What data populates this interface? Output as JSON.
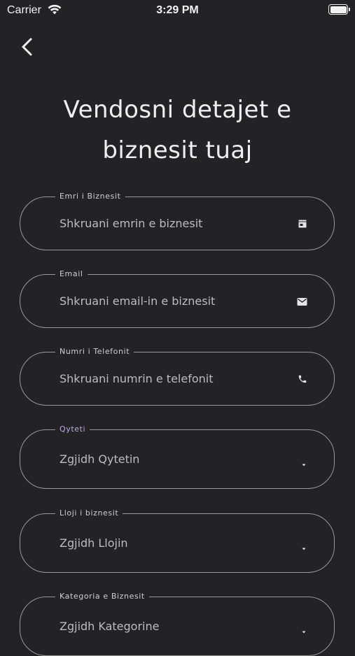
{
  "status_bar": {
    "carrier": "Carrier",
    "time": "3:29 PM"
  },
  "title": "Vendosni detajet e\nbiznesit tuaj",
  "fields": [
    {
      "label": "Emri i Biznesit",
      "placeholder": "Shkruani emrin e biznesit",
      "icon": "store-icon"
    },
    {
      "label": "Email",
      "placeholder": "Shkruani email-in e biznesit",
      "icon": "mail-icon"
    },
    {
      "label": "Numri i Telefonit",
      "placeholder": "Shkruani numrin e telefonit",
      "icon": "phone-icon"
    },
    {
      "label": "Qyteti",
      "placeholder": "Zgjidh Qytetin",
      "icon": "dropdown-arrow-icon"
    },
    {
      "label": "Lloji i biznesit",
      "placeholder": "Zgjidh Llojin",
      "icon": "dropdown-arrow-icon"
    },
    {
      "label": "Kategoria e Biznesit",
      "placeholder": "Zgjidh Kategorine",
      "icon": "dropdown-arrow-icon"
    }
  ],
  "colors": {
    "background": "#232224",
    "active_label": "#b9a8e6",
    "border": "#9a9a9a"
  }
}
